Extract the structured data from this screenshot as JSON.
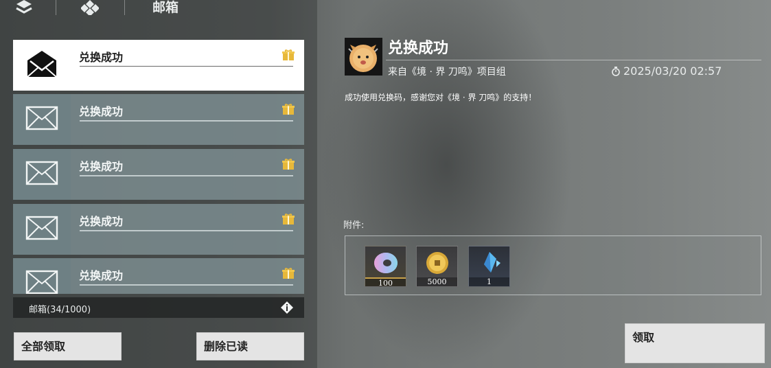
{
  "header": {
    "title": "邮箱"
  },
  "mail_list": [
    {
      "title": "兑换成功",
      "selected": true
    },
    {
      "title": "兑换成功",
      "selected": false
    },
    {
      "title": "兑换成功",
      "selected": false
    },
    {
      "title": "兑换成功",
      "selected": false
    },
    {
      "title": "兑换成功",
      "selected": false
    }
  ],
  "footer": {
    "mail_count": "邮箱(34/1000)",
    "claim_all_label": "全部领取",
    "delete_read_label": "删除已读"
  },
  "detail": {
    "title": "兑换成功",
    "sender": "来自《境 · 界 刀鸣》项目组",
    "time": "2025/03/20 02:57",
    "body": "成功使用兑换码，感谢您对《境 · 界 刀鸣》的支持！",
    "attachments_label": "附件:",
    "attachments": [
      {
        "name": "ring-currency",
        "qty": "100"
      },
      {
        "name": "gold-coin",
        "qty": "5000"
      },
      {
        "name": "blue-crystal",
        "qty": "1"
      }
    ],
    "claim_label": "领取"
  },
  "colors": {
    "gift": "#e7b83a",
    "selected_bg": "#ffffff",
    "item_bg": "#80929a"
  }
}
